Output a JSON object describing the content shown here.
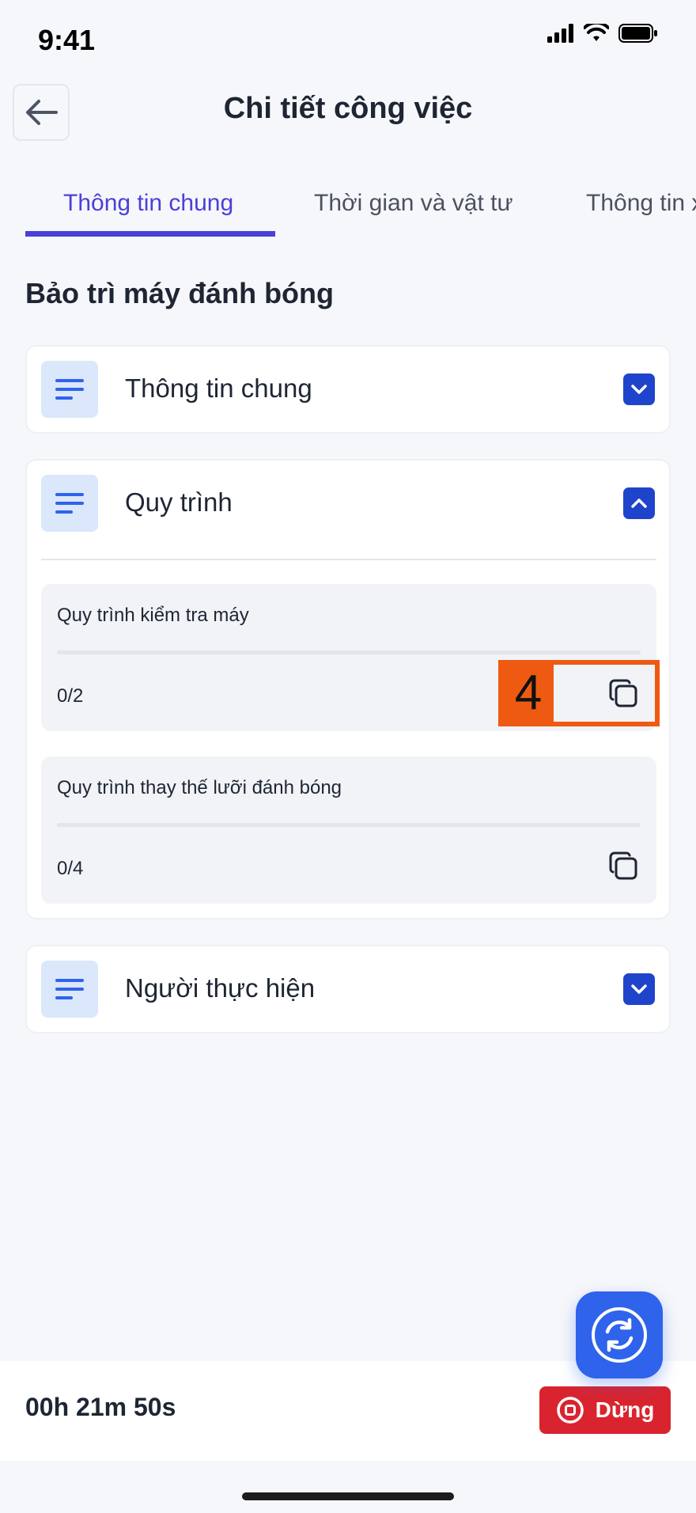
{
  "status_bar": {
    "time": "9:41"
  },
  "header": {
    "title": "Chi tiết công việc",
    "back_icon": "arrow-left-icon"
  },
  "tabs": [
    {
      "label": "Thông tin chung",
      "active": true
    },
    {
      "label": "Thời gian và vật tư",
      "active": false
    },
    {
      "label": "Thông tin x",
      "active": false
    }
  ],
  "job": {
    "title": "Bảo trì máy đánh bóng"
  },
  "sections": {
    "general": {
      "title": "Thông tin chung",
      "expanded": false
    },
    "process": {
      "title": "Quy trình",
      "expanded": true,
      "items": [
        {
          "name": "Quy trình kiểm tra máy",
          "count": "0/2",
          "progress": 0
        },
        {
          "name": "Quy trình thay thế lưỡi đánh bóng",
          "count": "0/4",
          "progress": 0
        }
      ]
    },
    "assignee": {
      "title": "Người thực hiện",
      "expanded": false
    }
  },
  "annotation": {
    "label": "4"
  },
  "bottom_bar": {
    "timer": "00h 21m 50s",
    "stop_label": "Dừng"
  },
  "colors": {
    "accent": "#4a40d8",
    "primary": "#1f44cc",
    "fab": "#2f63ec",
    "stop": "#d9242f",
    "marker": "#ee5a12"
  }
}
